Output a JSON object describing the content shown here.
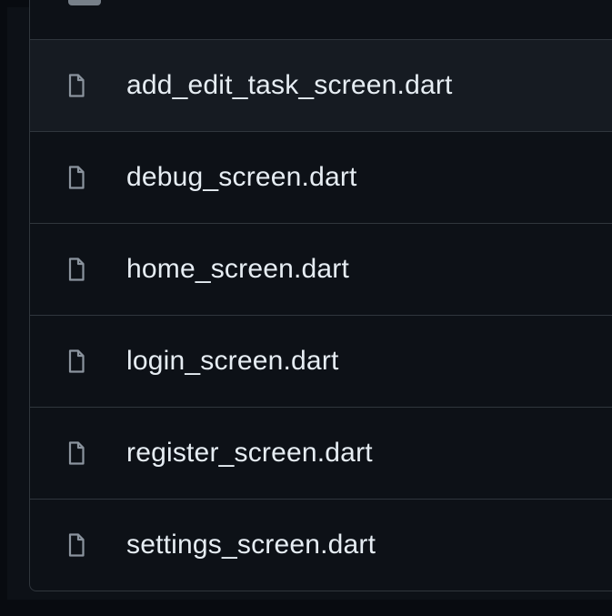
{
  "files": [
    {
      "name": "add_edit_task_screen.dart",
      "icon": "file-icon"
    },
    {
      "name": "debug_screen.dart",
      "icon": "file-icon"
    },
    {
      "name": "home_screen.dart",
      "icon": "file-icon"
    },
    {
      "name": "login_screen.dart",
      "icon": "file-icon"
    },
    {
      "name": "register_screen.dart",
      "icon": "file-icon"
    },
    {
      "name": "settings_screen.dart",
      "icon": "file-icon"
    }
  ],
  "colors": {
    "background": "#0d1117",
    "row_hover": "#161b22",
    "border": "#30363d",
    "text": "#e6edf3",
    "icon": "#8b949e"
  }
}
